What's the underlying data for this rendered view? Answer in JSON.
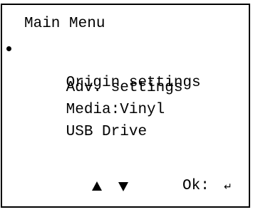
{
  "menu": {
    "title": "Main Menu",
    "items": [
      {
        "label": "Origin settings",
        "selected": true
      },
      {
        "label": "Adv. settings",
        "selected": false
      },
      {
        "label": "Media:Vinyl",
        "selected": false
      },
      {
        "label": "USB Drive",
        "selected": false
      }
    ]
  },
  "footer": {
    "up_icon": "up-arrow-icon",
    "down_icon": "down-arrow-icon",
    "ok_label": "Ok:",
    "enter_symbol": "↵",
    "enter_icon": "enter-return-icon"
  }
}
